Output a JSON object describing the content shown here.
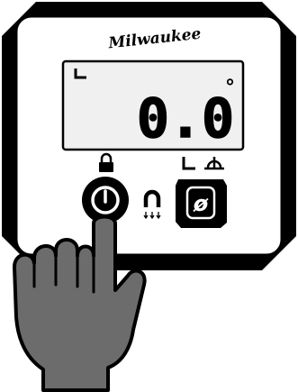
{
  "brand": {
    "name": "Milwaukee"
  },
  "display": {
    "mode_icon": "relative-angle-icon",
    "reading": "0.0",
    "unit": "°"
  },
  "controls": {
    "lock_icon": "lock-icon",
    "power_button_icon": "power-icon",
    "magnet_icon": "magnet-icon",
    "zero_button_label": "ø",
    "zero_button_icons": [
      "angle-mode-icon",
      "level-mode-icon"
    ]
  },
  "hand": {
    "icon": "pointing-hand-icon"
  },
  "colors": {
    "frame": "#000000",
    "faceplate": "#ffffff",
    "lcd": "#f0f0f0",
    "button": "#000000",
    "hand_fill": "#6c6c6c"
  }
}
